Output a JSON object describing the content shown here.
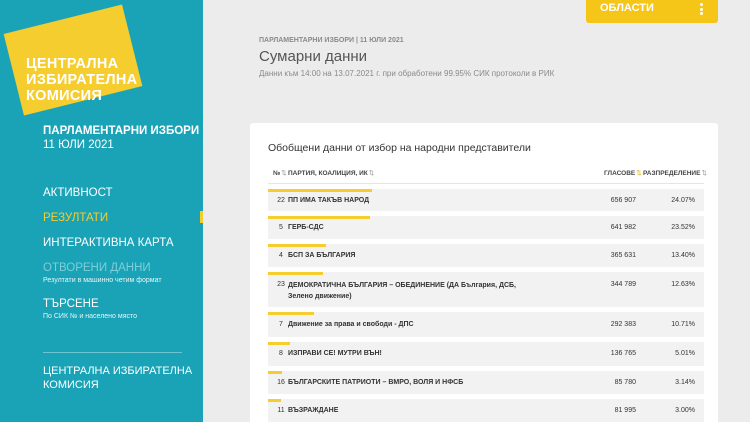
{
  "sidebar": {
    "logo_lines": [
      "ЦЕНТРАЛНА",
      "ИЗБИРАТЕЛНА",
      "КОМИСИЯ"
    ],
    "election_title": "ПАРЛАМЕНТАРНИ ИЗБОРИ",
    "election_date": "11 ЮЛИ 2021",
    "nav": {
      "activity": "АКТИВНОСТ",
      "results": "РЕЗУЛТАТИ",
      "map": "ИНТЕРАКТИВНА КАРТА",
      "open_data": "ОТВОРЕНИ ДАННИ",
      "open_data_sub": "Резултати в машинно четим формат",
      "search": "ТЪРСЕНЕ",
      "search_sub": "По СИК № и населено място"
    },
    "footer_lines": [
      "ЦЕНТРАЛНА ИЗБИРАТЕЛНА",
      "КОМИСИЯ"
    ]
  },
  "regions_button": "ОБЛАСТИ",
  "header": {
    "breadcrumb": "ПАРЛАМЕНТАРНИ ИЗБОРИ | 11 ЮЛИ 2021",
    "title": "Сумарни данни",
    "subtitle": "Данни към 14:00 на 13.07.2021 г. при обработени 99.95% СИК протоколи в РИК"
  },
  "table": {
    "title": "Обобщени данни от избор на народни представители",
    "headers": {
      "num": "№",
      "party": "ПАРТИЯ, КОАЛИЦИЯ, ИК",
      "votes": "ГЛАСОВЕ",
      "share": "РАЗПРЕДЕЛЕНИЕ"
    },
    "rows": [
      {
        "num": "22",
        "party": "ПП ИМА ТАКЪВ НАРОД",
        "votes": "656 907",
        "pct": "24.07%",
        "share": 24.07
      },
      {
        "num": "5",
        "party": "ГЕРБ-СДС",
        "votes": "641 982",
        "pct": "23.52%",
        "share": 23.52
      },
      {
        "num": "4",
        "party": "БСП ЗА БЪЛГАРИЯ",
        "votes": "365 631",
        "pct": "13.40%",
        "share": 13.4
      },
      {
        "num": "23",
        "party": "ДЕМОКРАТИЧНА БЪЛГАРИЯ – ОБЕДИНЕНИЕ (ДА България, ДСБ, Зелено движение)",
        "votes": "344 789",
        "pct": "12.63%",
        "share": 12.63
      },
      {
        "num": "7",
        "party": "Движение за права и свободи - ДПС",
        "votes": "292 383",
        "pct": "10.71%",
        "share": 10.71
      },
      {
        "num": "8",
        "party": "ИЗПРАВИ СЕ! МУТРИ ВЪН!",
        "votes": "136 765",
        "pct": "5.01%",
        "share": 5.01
      },
      {
        "num": "16",
        "party": "БЪЛГАРСКИТЕ ПАТРИОТИ – ВМРО, ВОЛЯ И НФСБ",
        "votes": "85 780",
        "pct": "3.14%",
        "share": 3.14
      },
      {
        "num": "11",
        "party": "ВЪЗРАЖДАНЕ",
        "votes": "81 995",
        "pct": "3.00%",
        "share": 3.0
      }
    ]
  },
  "colors": {
    "sidebar": "#1aa3b7",
    "accent": "#f5cd2e"
  }
}
